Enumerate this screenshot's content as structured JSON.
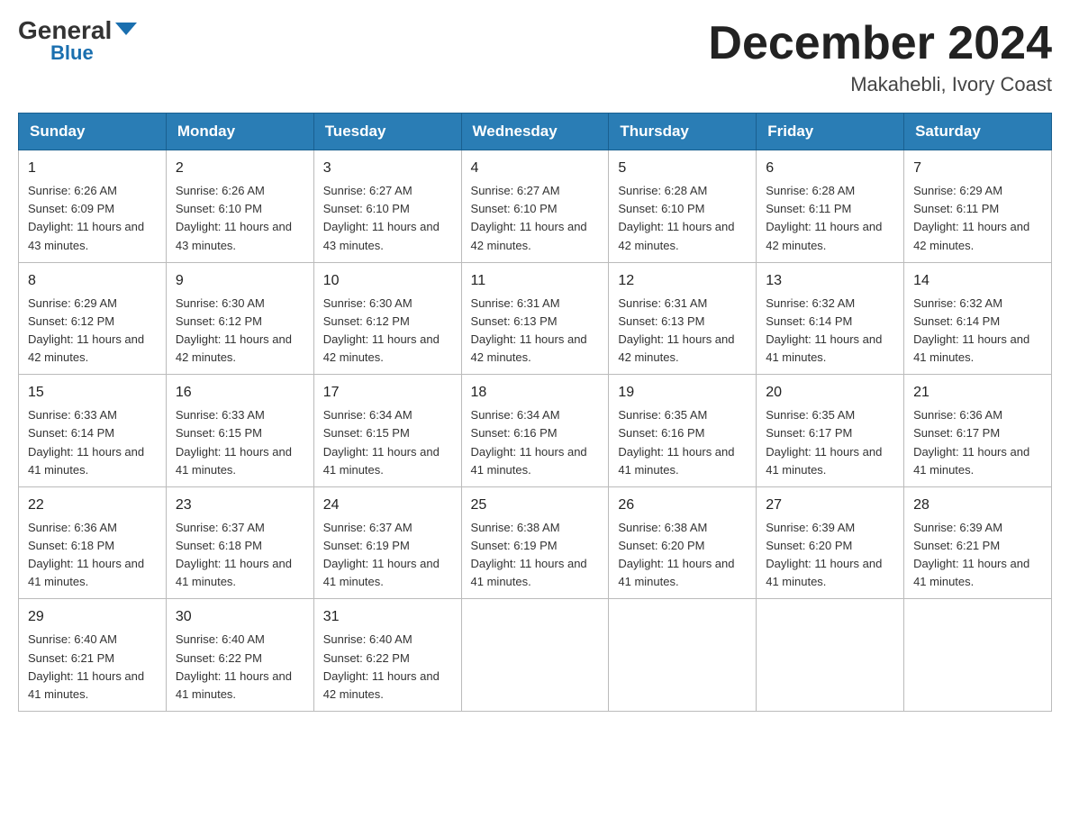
{
  "header": {
    "logo_general": "General",
    "logo_blue": "Blue",
    "month_title": "December 2024",
    "location": "Makahebli, Ivory Coast"
  },
  "days_of_week": [
    "Sunday",
    "Monday",
    "Tuesday",
    "Wednesday",
    "Thursday",
    "Friday",
    "Saturday"
  ],
  "weeks": [
    [
      {
        "day": "1",
        "sunrise": "Sunrise: 6:26 AM",
        "sunset": "Sunset: 6:09 PM",
        "daylight": "Daylight: 11 hours and 43 minutes."
      },
      {
        "day": "2",
        "sunrise": "Sunrise: 6:26 AM",
        "sunset": "Sunset: 6:10 PM",
        "daylight": "Daylight: 11 hours and 43 minutes."
      },
      {
        "day": "3",
        "sunrise": "Sunrise: 6:27 AM",
        "sunset": "Sunset: 6:10 PM",
        "daylight": "Daylight: 11 hours and 43 minutes."
      },
      {
        "day": "4",
        "sunrise": "Sunrise: 6:27 AM",
        "sunset": "Sunset: 6:10 PM",
        "daylight": "Daylight: 11 hours and 42 minutes."
      },
      {
        "day": "5",
        "sunrise": "Sunrise: 6:28 AM",
        "sunset": "Sunset: 6:10 PM",
        "daylight": "Daylight: 11 hours and 42 minutes."
      },
      {
        "day": "6",
        "sunrise": "Sunrise: 6:28 AM",
        "sunset": "Sunset: 6:11 PM",
        "daylight": "Daylight: 11 hours and 42 minutes."
      },
      {
        "day": "7",
        "sunrise": "Sunrise: 6:29 AM",
        "sunset": "Sunset: 6:11 PM",
        "daylight": "Daylight: 11 hours and 42 minutes."
      }
    ],
    [
      {
        "day": "8",
        "sunrise": "Sunrise: 6:29 AM",
        "sunset": "Sunset: 6:12 PM",
        "daylight": "Daylight: 11 hours and 42 minutes."
      },
      {
        "day": "9",
        "sunrise": "Sunrise: 6:30 AM",
        "sunset": "Sunset: 6:12 PM",
        "daylight": "Daylight: 11 hours and 42 minutes."
      },
      {
        "day": "10",
        "sunrise": "Sunrise: 6:30 AM",
        "sunset": "Sunset: 6:12 PM",
        "daylight": "Daylight: 11 hours and 42 minutes."
      },
      {
        "day": "11",
        "sunrise": "Sunrise: 6:31 AM",
        "sunset": "Sunset: 6:13 PM",
        "daylight": "Daylight: 11 hours and 42 minutes."
      },
      {
        "day": "12",
        "sunrise": "Sunrise: 6:31 AM",
        "sunset": "Sunset: 6:13 PM",
        "daylight": "Daylight: 11 hours and 42 minutes."
      },
      {
        "day": "13",
        "sunrise": "Sunrise: 6:32 AM",
        "sunset": "Sunset: 6:14 PM",
        "daylight": "Daylight: 11 hours and 41 minutes."
      },
      {
        "day": "14",
        "sunrise": "Sunrise: 6:32 AM",
        "sunset": "Sunset: 6:14 PM",
        "daylight": "Daylight: 11 hours and 41 minutes."
      }
    ],
    [
      {
        "day": "15",
        "sunrise": "Sunrise: 6:33 AM",
        "sunset": "Sunset: 6:14 PM",
        "daylight": "Daylight: 11 hours and 41 minutes."
      },
      {
        "day": "16",
        "sunrise": "Sunrise: 6:33 AM",
        "sunset": "Sunset: 6:15 PM",
        "daylight": "Daylight: 11 hours and 41 minutes."
      },
      {
        "day": "17",
        "sunrise": "Sunrise: 6:34 AM",
        "sunset": "Sunset: 6:15 PM",
        "daylight": "Daylight: 11 hours and 41 minutes."
      },
      {
        "day": "18",
        "sunrise": "Sunrise: 6:34 AM",
        "sunset": "Sunset: 6:16 PM",
        "daylight": "Daylight: 11 hours and 41 minutes."
      },
      {
        "day": "19",
        "sunrise": "Sunrise: 6:35 AM",
        "sunset": "Sunset: 6:16 PM",
        "daylight": "Daylight: 11 hours and 41 minutes."
      },
      {
        "day": "20",
        "sunrise": "Sunrise: 6:35 AM",
        "sunset": "Sunset: 6:17 PM",
        "daylight": "Daylight: 11 hours and 41 minutes."
      },
      {
        "day": "21",
        "sunrise": "Sunrise: 6:36 AM",
        "sunset": "Sunset: 6:17 PM",
        "daylight": "Daylight: 11 hours and 41 minutes."
      }
    ],
    [
      {
        "day": "22",
        "sunrise": "Sunrise: 6:36 AM",
        "sunset": "Sunset: 6:18 PM",
        "daylight": "Daylight: 11 hours and 41 minutes."
      },
      {
        "day": "23",
        "sunrise": "Sunrise: 6:37 AM",
        "sunset": "Sunset: 6:18 PM",
        "daylight": "Daylight: 11 hours and 41 minutes."
      },
      {
        "day": "24",
        "sunrise": "Sunrise: 6:37 AM",
        "sunset": "Sunset: 6:19 PM",
        "daylight": "Daylight: 11 hours and 41 minutes."
      },
      {
        "day": "25",
        "sunrise": "Sunrise: 6:38 AM",
        "sunset": "Sunset: 6:19 PM",
        "daylight": "Daylight: 11 hours and 41 minutes."
      },
      {
        "day": "26",
        "sunrise": "Sunrise: 6:38 AM",
        "sunset": "Sunset: 6:20 PM",
        "daylight": "Daylight: 11 hours and 41 minutes."
      },
      {
        "day": "27",
        "sunrise": "Sunrise: 6:39 AM",
        "sunset": "Sunset: 6:20 PM",
        "daylight": "Daylight: 11 hours and 41 minutes."
      },
      {
        "day": "28",
        "sunrise": "Sunrise: 6:39 AM",
        "sunset": "Sunset: 6:21 PM",
        "daylight": "Daylight: 11 hours and 41 minutes."
      }
    ],
    [
      {
        "day": "29",
        "sunrise": "Sunrise: 6:40 AM",
        "sunset": "Sunset: 6:21 PM",
        "daylight": "Daylight: 11 hours and 41 minutes."
      },
      {
        "day": "30",
        "sunrise": "Sunrise: 6:40 AM",
        "sunset": "Sunset: 6:22 PM",
        "daylight": "Daylight: 11 hours and 41 minutes."
      },
      {
        "day": "31",
        "sunrise": "Sunrise: 6:40 AM",
        "sunset": "Sunset: 6:22 PM",
        "daylight": "Daylight: 11 hours and 42 minutes."
      },
      null,
      null,
      null,
      null
    ]
  ]
}
